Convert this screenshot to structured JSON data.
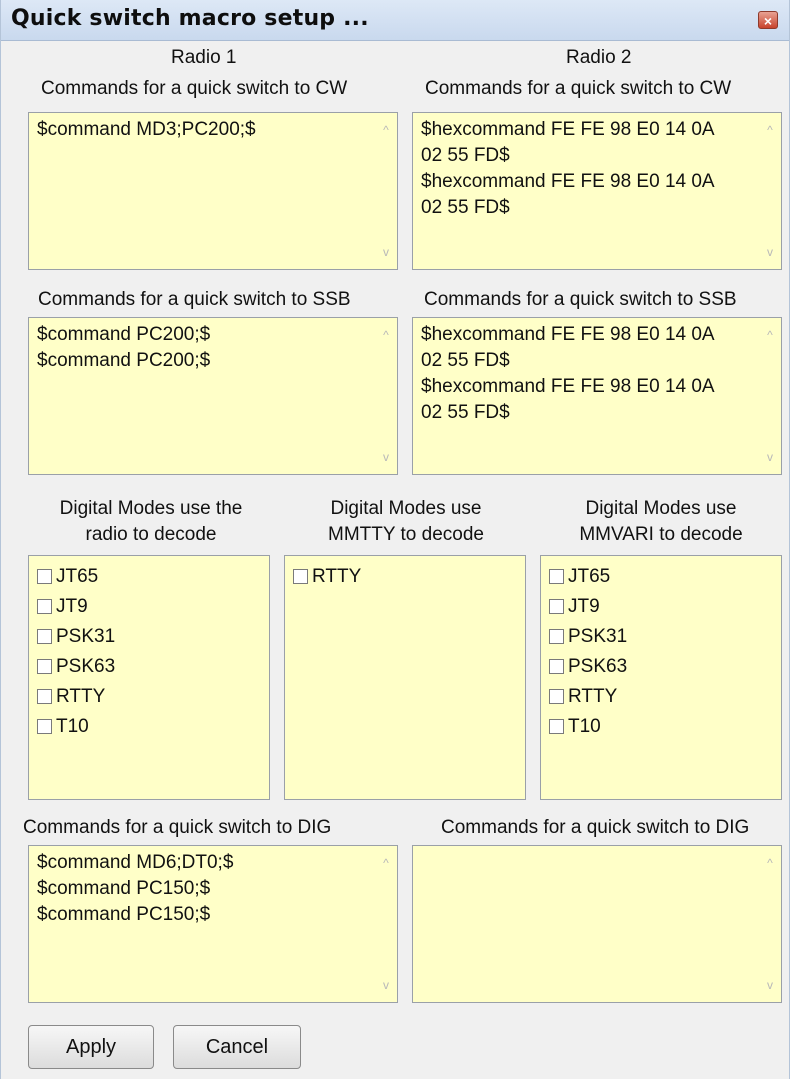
{
  "window": {
    "title": "Quick switch macro setup ...",
    "close_glyph": "×"
  },
  "radio1": {
    "header": "Radio 1"
  },
  "radio2": {
    "header": "Radio 2"
  },
  "cw": {
    "label1": "Commands for a quick switch to CW",
    "label2": "Commands for a quick switch to CW",
    "radio1_lines": [
      "$command MD3;PC200;$"
    ],
    "radio2_lines": [
      "$hexcommand FE FE 98 E0 14 0A",
      "02 55 FD$",
      "$hexcommand FE FE 98 E0 14 0A",
      "02 55 FD$"
    ]
  },
  "ssb": {
    "label1": "Commands for a quick switch to SSB",
    "label2": "Commands for a quick switch to SSB",
    "radio1_lines": [
      "$command PC200;$",
      "$command PC200;$"
    ],
    "radio2_lines": [
      "$hexcommand FE FE 98 E0 14 0A",
      "02 55 FD$",
      "$hexcommand FE FE 98 E0 14 0A",
      "02 55 FD$"
    ]
  },
  "digital": {
    "radio_decode": {
      "label_line1": "Digital Modes use the",
      "label_line2": "radio to decode",
      "items": [
        "JT65",
        "JT9",
        "PSK31",
        "PSK63",
        "RTTY",
        "T10"
      ]
    },
    "mmtty_decode": {
      "label_line1": "Digital Modes use",
      "label_line2": "MMTTY to decode",
      "items": [
        "RTTY"
      ]
    },
    "mmvari_decode": {
      "label_line1": "Digital Modes use",
      "label_line2": "MMVARI to decode",
      "items": [
        "JT65",
        "JT9",
        "PSK31",
        "PSK63",
        "RTTY",
        "T10"
      ]
    }
  },
  "dig": {
    "label1": "Commands for a quick switch to DIG",
    "label2": "Commands for a quick switch to DIG",
    "radio1_lines": [
      "$command MD6;DT0;$",
      "$command PC150;$",
      "$command PC150;$"
    ],
    "radio2_lines": []
  },
  "buttons": {
    "apply": "Apply",
    "cancel": "Cancel"
  },
  "scroll_glyphs": {
    "up": "^",
    "down": "v"
  },
  "colors": {
    "field_bg": "#ffffc8",
    "window_bg": "#f0f0f0"
  }
}
